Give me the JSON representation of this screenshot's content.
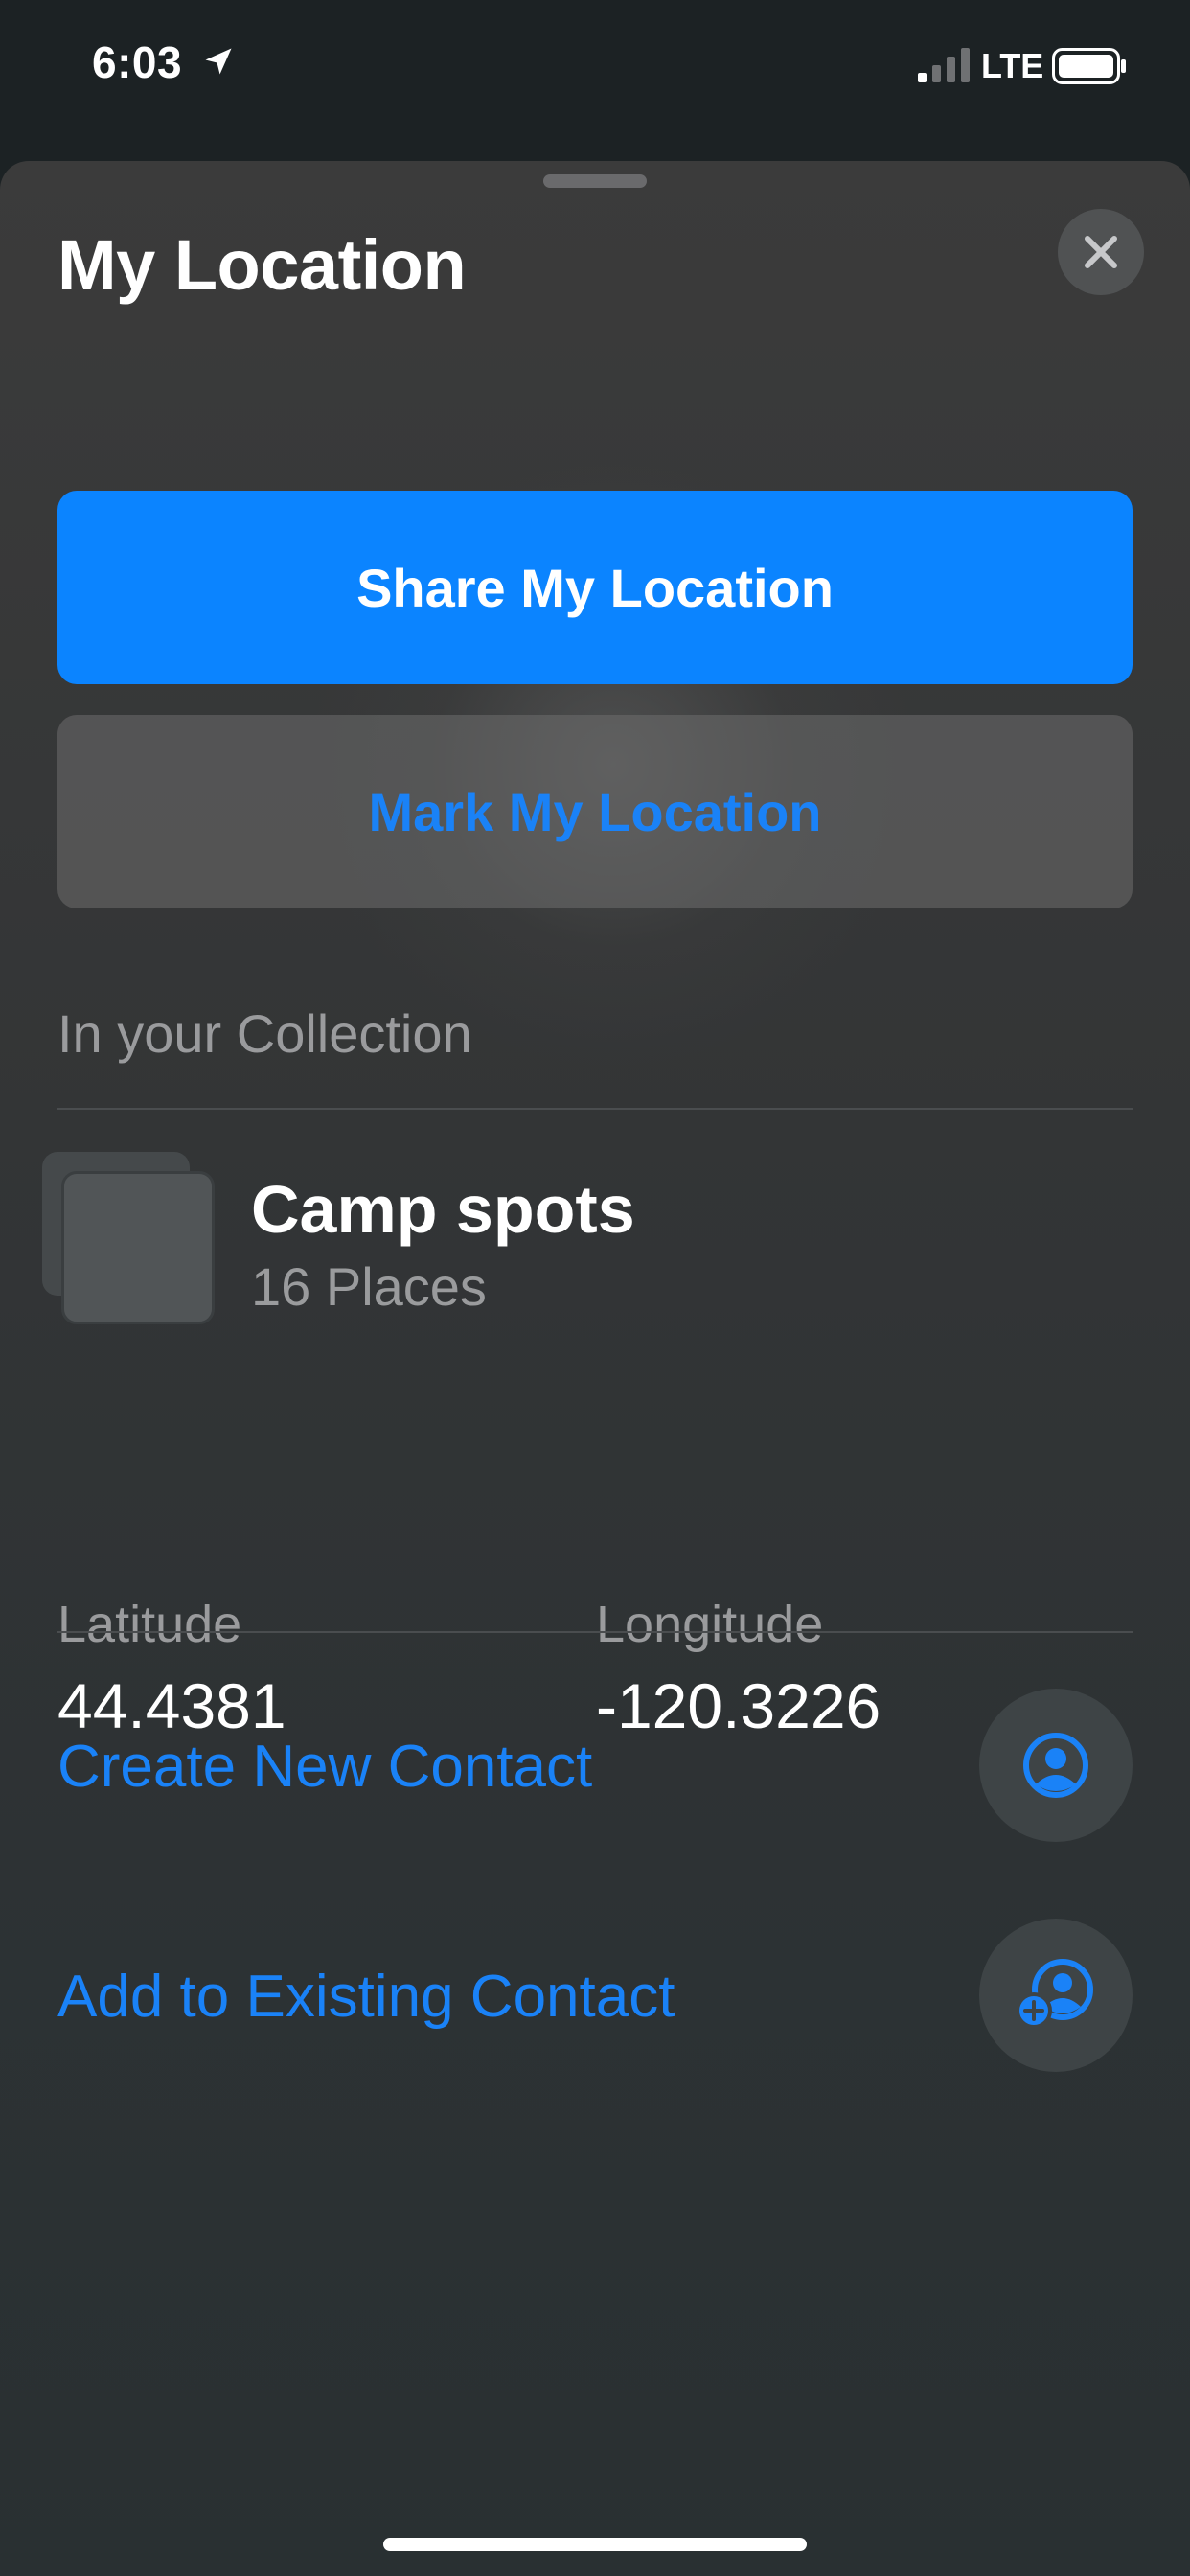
{
  "status_bar": {
    "time": "6:03",
    "carrier": "LTE",
    "icons": [
      "location-arrow-icon",
      "signal-bars-icon",
      "battery-icon"
    ]
  },
  "sheet": {
    "title": "My Location",
    "close_icon": "close-icon"
  },
  "actions": {
    "share_label": "Share My Location",
    "mark_label": "Mark My Location"
  },
  "collection": {
    "header": "In your Collection",
    "name": "Camp spots",
    "count": "16 Places"
  },
  "coordinates": {
    "latitude_label": "Latitude",
    "latitude_value": "44.4381",
    "longitude_label": "Longitude",
    "longitude_value": "-120.3226"
  },
  "contacts": {
    "create_label": "Create New Contact",
    "create_icon": "person-circle-icon",
    "add_label": "Add to Existing Contact",
    "add_icon": "person-add-icon"
  },
  "colors": {
    "accent": "#0b84ff",
    "link": "#1a82f7",
    "secondary_text": "#9a9b9d"
  }
}
